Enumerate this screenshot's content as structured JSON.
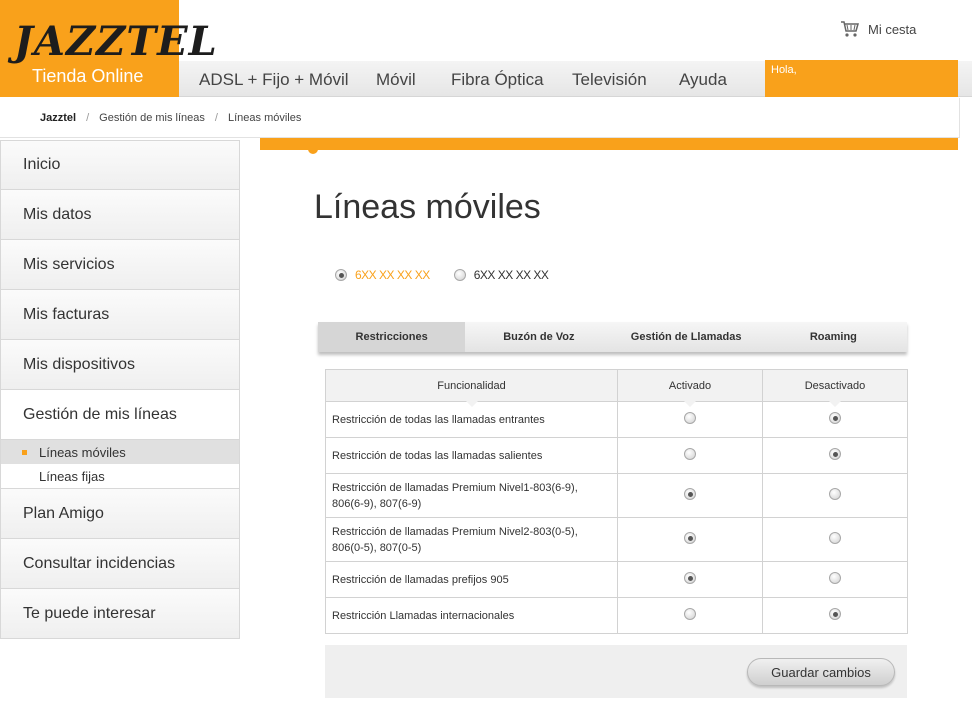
{
  "brand": {
    "logo_text": "JAZZTEL",
    "subtitle": "Tienda Online",
    "color": "#f9a11b"
  },
  "cart": {
    "label": "Mi cesta",
    "icon": "cart-icon"
  },
  "nav": {
    "items": [
      "ADSL + Fijo + Móvil",
      "Móvil",
      "Fibra Óptica",
      "Televisión",
      "Ayuda"
    ],
    "greeting": "Hola,"
  },
  "breadcrumb": [
    "Jazztel",
    "Gestión de mis líneas",
    "Líneas móviles"
  ],
  "sidebar": {
    "items": [
      "Inicio",
      "Mis datos",
      "Mis servicios",
      "Mis facturas",
      "Mis dispositivos",
      "Gestión de mis líneas",
      "Plan Amigo",
      "Consultar incidencias",
      "Te puede interesar"
    ],
    "subitems": [
      "Líneas móviles",
      "Líneas fijas"
    ]
  },
  "main": {
    "title": "Líneas móviles",
    "lines": [
      {
        "number": "6XX XX XX XX",
        "selected": true
      },
      {
        "number": "6XX XX XX XX",
        "selected": false
      }
    ],
    "tabs": [
      "Restricciones",
      "Buzón de Voz",
      "Gestión de Llamadas",
      "Roaming"
    ],
    "table": {
      "headers": [
        "Funcionalidad",
        "Activado",
        "Desactivado"
      ],
      "rows": [
        {
          "text": "Restricción de todas las llamadas entrantes",
          "activado": false
        },
        {
          "text": "Restricción de todas las llamadas salientes",
          "activado": false
        },
        {
          "text": "Restricción de llamadas Premium Nivel1-803(6-9), 806(6-9), 807(6-9)",
          "activado": true
        },
        {
          "text": "Restricción de llamadas Premium Nivel2-803(0-5), 806(0-5), 807(0-5)",
          "activado": true
        },
        {
          "text": "Restricción de llamadas prefijos 905",
          "activado": true
        },
        {
          "text": "Restricción Llamadas internacionales",
          "activado": false
        }
      ]
    },
    "save_label": "Guardar cambios"
  }
}
